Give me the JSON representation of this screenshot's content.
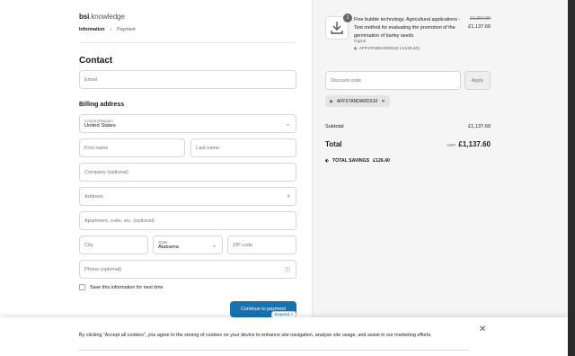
{
  "header": {
    "logo_bold": "bsi",
    "logo_rest": ".knowledge",
    "breadcrumb": [
      {
        "label": "Information",
        "current": true
      },
      {
        "label": "Payment",
        "current": false
      }
    ]
  },
  "contact": {
    "title": "Contact",
    "email_placeholder": "Email"
  },
  "billing": {
    "title": "Billing address",
    "country_label": "Country/Region",
    "country_value": "United States",
    "first_name_placeholder": "First name",
    "last_name_placeholder": "Last name",
    "company_placeholder": "Company (optional)",
    "address_placeholder": "Address",
    "apartment_placeholder": "Apartment, suite, etc. (optional)",
    "city_placeholder": "City",
    "state_label": "State",
    "state_value": "Alabama",
    "zip_placeholder": "ZIP code",
    "phone_placeholder": "Phone (optional)",
    "save_info_label": "Save this information for next time",
    "continue_label": "Continue to payment",
    "expand_label": "Expand"
  },
  "cookie": {
    "text": "By clicking “Accept all cookies”, you agree to the storing of cookies on your device to enhance site navigation, analyse site usage, and assist in our marketing efforts."
  },
  "summary": {
    "item": {
      "quantity": "1",
      "title": "Fine bubble technology. Agricultural applications - Test method for evaluating the promotion of the germination of barley seeds",
      "format": "Digital",
      "discount_line": "AFFSTANDARDS10 (-£126.40)",
      "price_original": "£1,264.00",
      "price_final": "£1,137.60"
    },
    "discount_placeholder": "Discount code",
    "apply_label": "Apply",
    "applied_code": "AFFSTANDARDS10",
    "subtotal_label": "Subtotal",
    "subtotal_value": "£1,137.60",
    "total_label": "Total",
    "total_currency": "GBP",
    "total_value": "£1,137.60",
    "savings_label": "TOTAL SAVINGS",
    "savings_value": "£126.40"
  }
}
